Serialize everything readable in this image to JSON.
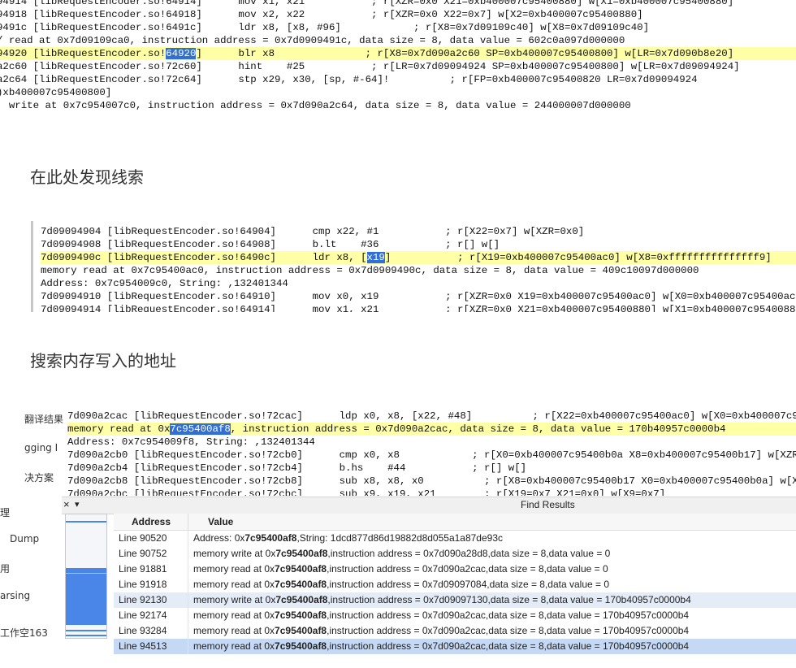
{
  "block1": {
    "lines": [
      {
        "text": "94914 [libRequestEncoder.so!64914]      mov x1, x21           ; r[XZR=0x0 X21=0xb400007c95400880] w[X1=0xb400007c95400880]",
        "hl": false
      },
      {
        "text": "94918 [libRequestEncoder.so!64918]      mov x2, x22           ; r[XZR=0x0 X22=0x7] w[X2=0xb400007c95400880]",
        "hl": false
      },
      {
        "text": "9491c [libRequestEncoder.so!6491c]      ldr x8, [x8, #96]            ; r[X8=0x7d09109c40] w[X8=0x7d09109c40]",
        "hl": false
      },
      {
        "text": "/ read at 0x7d09109ca0, instruction address = 0x7d0909491c, data size = 8, data value = 602c0a097d000000",
        "hl": false
      },
      {
        "text": "94920 [libRequestEncoder.so!",
        "sel": "64920",
        "rest": "]      blr x8               ; r[X8=0x7d090a2c60 SP=0xb400007c95400800] w[LR=0x7d090b8e20]",
        "hl": true
      },
      {
        "text": "a2c60 [libRequestEncoder.so!72c60]      hint    #25           ; r[LR=0x7d09094924 SP=0xb400007c95400800] w[LR=0x7d09094924]",
        "hl": false
      },
      {
        "text": "a2c64 [libRequestEncoder.so!72c64]      stp x29, x30, [sp, #-64]!          ; r[FP=0xb400007c95400820 LR=0x7d09094924",
        "hl": false
      },
      {
        "text": ")xb400007c95400800]",
        "hl": false
      },
      {
        "text": "  write at 0x7c954007c0, instruction address = 0x7d090a2c64, data size = 8, data value = 244000007d000000",
        "hl": false
      }
    ]
  },
  "annotation1": "在此处发现线索",
  "block2": {
    "lines": [
      {
        "text": "7d09094904 [libRequestEncoder.so!64904]      cmp x22, #1           ; r[X22=0x7] w[XZR=0x0]",
        "hl": false
      },
      {
        "text": "7d09094908 [libRequestEncoder.so!64908]      b.lt    #36           ; r[] w[]",
        "hl": false
      },
      {
        "text": "7d0909490c [libRequestEncoder.so!6490c]      ldr x8, [",
        "sel": "x19",
        "rest": "]           ; r[X19=0xb400007c95400ac0] w[X8=0xfffffffffffffff9]",
        "hl": true
      },
      {
        "text": "memory read at 0x7c95400ac0, instruction address = 0x7d0909490c, data size = 8, data value = 409c10097d000000",
        "hl": false
      },
      {
        "text": "Address: 0x7c954009c0, String: ,132401344",
        "hl": false
      },
      {
        "text": "7d09094910 [libRequestEncoder.so!64910]      mov x0, x19           ; r[XZR=0x0 X19=0xb400007c95400ac0] w[X0=0xb400007c95400ac0]",
        "hl": false
      },
      {
        "text": "7d09094914 [libRequestEncoder.so!64914]      mov x1, x21           ; r[XZR=0x0 X21=0xb400007c95400880] w[X1=0xb400007c95400880]",
        "hl": false
      }
    ]
  },
  "annotation2": "搜索内存写入的地址",
  "block3": {
    "lines": [
      {
        "text": "7d090a2cac [libRequestEncoder.so!72cac]      ldp x0, x8, [x22, #48]          ; r[X22=0xb400007c95400ac0] w[X0=0xb400007c95",
        "hl": false
      },
      {
        "text": "memory read at 0x",
        "sel": "7c95400af8",
        "rest": ", instruction address = 0x7d090a2cac, data size = 8, data value = 170b40957c0000b4",
        "hl": true
      },
      {
        "text": "Address: 0x7c954009f8, String: ,132401344",
        "hl": false
      },
      {
        "text": "7d090a2cb0 [libRequestEncoder.so!72cb0]      cmp x0, x8            ; r[X0=0xb400007c95400b0a X8=0xb400007c95400b17] w[XZR=0x",
        "hl": false
      },
      {
        "text": "7d090a2cb4 [libRequestEncoder.so!72cb4]      b.hs    #44           ; r[] w[]",
        "hl": false
      },
      {
        "text": "7d090a2cb8 [libRequestEncoder.so!72cb8]      sub x8, x8, x0          ; r[X8=0xb400007c95400b17 X0=0xb400007c95400b0a] w[X8",
        "hl": false
      },
      {
        "text": "7d090a2cbc [libRequestEncoder.so!72cbc]      sub x9, x19, x21        ; r[X19=0x7 X21=0x0] w[X9=0x7]",
        "hl": false
      }
    ]
  },
  "sidebar": {
    "items": [
      "翻译结果",
      "gging I",
      "决方案",
      "理",
      "Dump",
      "用",
      "arsing",
      "工作空163"
    ]
  },
  "find_results": {
    "close_label": "×",
    "dropdown_label": "▾",
    "title": "Find Results",
    "col_address": "Address",
    "col_value": "Value",
    "rows": [
      {
        "address": "Line 90520",
        "pre": "Address: 0x",
        "bold": "7c95400af8",
        "post": ",String: 1dcd877d86d19882d8d055a1a87de93c",
        "style": ""
      },
      {
        "address": "Line 90752",
        "pre": "memory write at 0x",
        "bold": "7c95400af8",
        "post": ",instruction address = 0x7d090a28d8,data size = 8,data value = 0",
        "style": ""
      },
      {
        "address": "Line 91881",
        "pre": "memory read at 0x",
        "bold": "7c95400af8",
        "post": ",instruction address = 0x7d090a2cac,data size = 8,data value = 0",
        "style": ""
      },
      {
        "address": "Line 91918",
        "pre": "memory read at 0x",
        "bold": "7c95400af8",
        "post": ",instruction address = 0x7d09097084,data size = 8,data value = 0",
        "style": ""
      },
      {
        "address": "Line 92130",
        "pre": "memory write at 0x",
        "bold": "7c95400af8",
        "post": ",instruction address = 0x7d09097130,data size = 8,data value = 170b40957c0000b4",
        "style": "sel1"
      },
      {
        "address": "Line 92174",
        "pre": "memory read at 0x",
        "bold": "7c95400af8",
        "post": ",instruction address = 0x7d090a2cac,data size = 8,data value = 170b40957c0000b4",
        "style": ""
      },
      {
        "address": "Line 93284",
        "pre": "memory read at 0x",
        "bold": "7c95400af8",
        "post": ",instruction address = 0x7d090a2cac,data size = 8,data value = 170b40957c0000b4",
        "style": ""
      },
      {
        "address": "Line 94513",
        "pre": "memory read at 0x",
        "bold": "7c95400af8",
        "post": ",instruction address = 0x7d090a2cac,data size = 8,data value = 170b40957c0000b4",
        "style": "sel2"
      }
    ]
  }
}
